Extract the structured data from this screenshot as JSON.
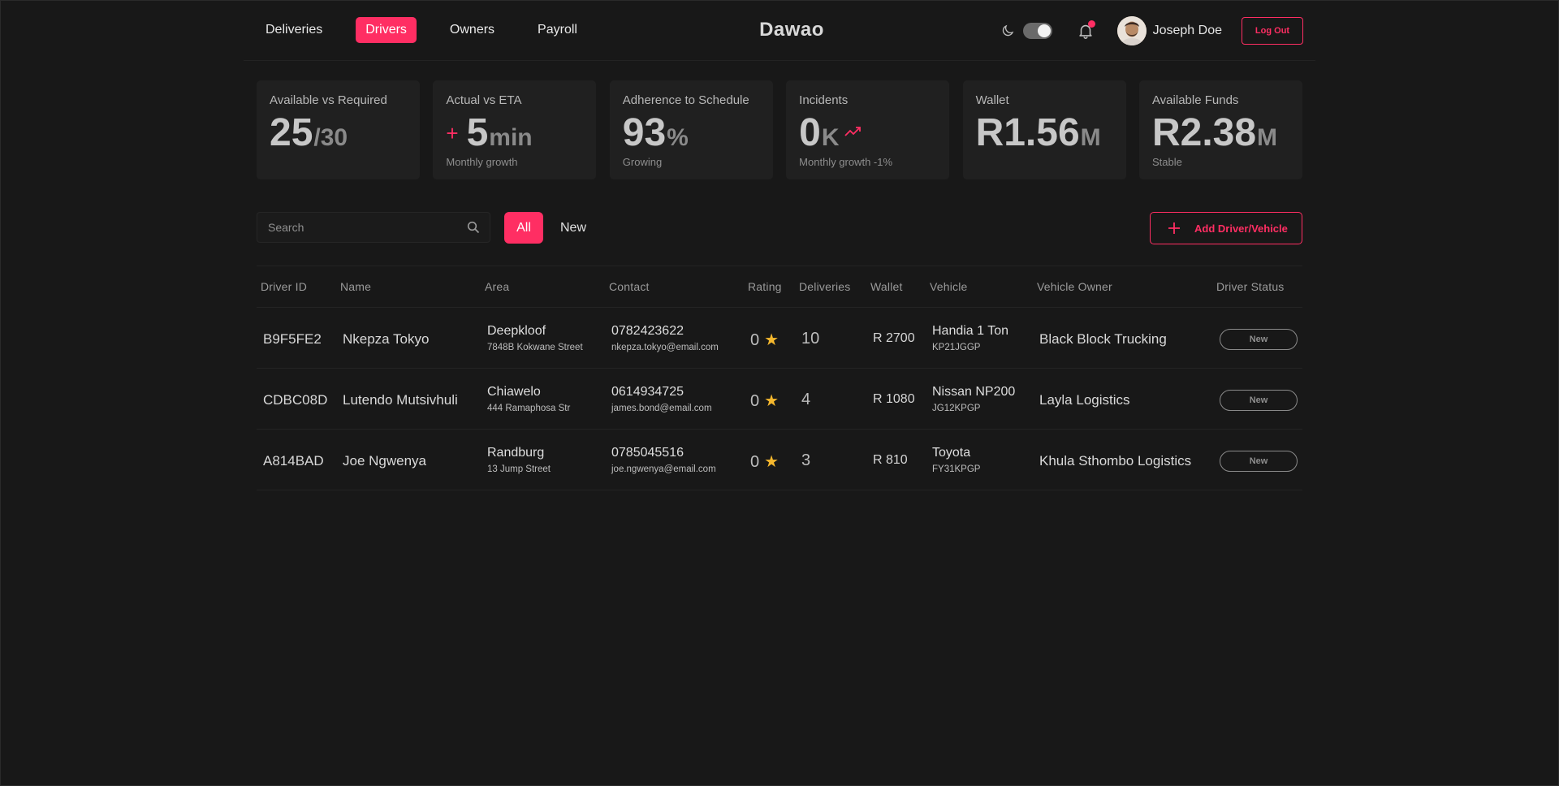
{
  "nav": {
    "items": [
      {
        "label": "Deliveries",
        "active": false
      },
      {
        "label": "Drivers",
        "active": true
      },
      {
        "label": "Owners",
        "active": false
      },
      {
        "label": "Payroll",
        "active": false
      }
    ]
  },
  "brand": "Dawao",
  "user": {
    "name": "Joseph Doe",
    "logout_label": "Log Out",
    "dark_mode": true,
    "has_notification": true
  },
  "stats": [
    {
      "title": "Available vs Required",
      "value": "25",
      "unit": "/30",
      "sub": ""
    },
    {
      "title": "Actual vs ETA",
      "prefix": "+",
      "value": "5",
      "unit": "min",
      "sub": "Monthly growth"
    },
    {
      "title": "Adherence to Schedule",
      "value": "93",
      "unit": "%",
      "sub": "Growing"
    },
    {
      "title": "Incidents",
      "value": "0",
      "unit": "K",
      "sub": "Monthly growth -1%",
      "trend_icon": "trend-up-icon"
    },
    {
      "title": "Wallet",
      "value": "R1.56",
      "unit": "M",
      "sub": ""
    },
    {
      "title": "Available Funds",
      "value": "R2.38",
      "unit": "M",
      "sub": "Stable"
    }
  ],
  "filters": {
    "search_placeholder": "Search",
    "all_label": "All",
    "new_label": "New",
    "add_label": "Add Driver/Vehicle"
  },
  "table": {
    "headers": [
      "Driver ID",
      "Name",
      "Area",
      "Contact",
      "Rating",
      "Deliveries",
      "Wallet",
      "Vehicle",
      "Vehicle Owner",
      "Driver Status"
    ],
    "rows": [
      {
        "id": "B9F5FE2",
        "name": "Nkepza Tokyo",
        "area": "Deepkloof",
        "address": "7848B Kokwane Street",
        "phone": "0782423622",
        "email": "nkepza.tokyo@email.com",
        "rating": "0",
        "deliveries": "10",
        "wallet": "R 2700",
        "vehicle": "Handia 1 Ton",
        "plate": "KP21JGGP",
        "owner": "Black Block Trucking",
        "status": "New"
      },
      {
        "id": "CDBC08D",
        "name": "Lutendo Mutsivhuli",
        "area": "Chiawelo",
        "address": "444 Ramaphosa Str",
        "phone": "0614934725",
        "email": "james.bond@email.com",
        "rating": "0",
        "deliveries": "4",
        "wallet": "R 1080",
        "vehicle": "Nissan NP200",
        "plate": "JG12KPGP",
        "owner": "Layla Logistics",
        "status": "New"
      },
      {
        "id": "A814BAD",
        "name": "Joe Ngwenya",
        "area": "Randburg",
        "address": "13 Jump Street",
        "phone": "0785045516",
        "email": "joe.ngwenya@email.com",
        "rating": "0",
        "deliveries": "3",
        "wallet": "R 810",
        "vehicle": "Toyota",
        "plate": "FY31KPGP",
        "owner": "Khula Sthombo Logistics",
        "status": "New"
      }
    ]
  },
  "colors": {
    "accent": "#ff2e63",
    "background": "#181818",
    "card": "#202020",
    "star": "#f5b82e"
  }
}
